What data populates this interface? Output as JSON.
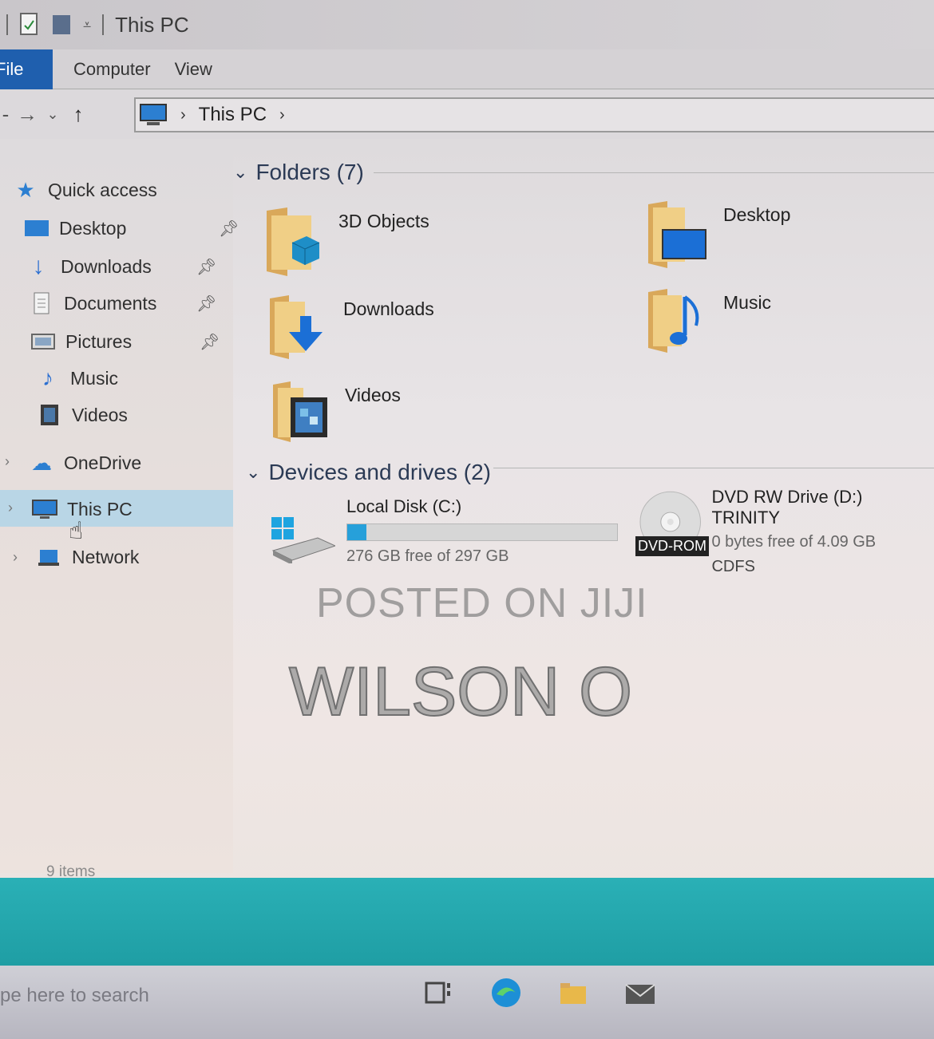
{
  "window": {
    "title": "This PC"
  },
  "ribbon": {
    "file": "File",
    "tabs": [
      "Computer",
      "View"
    ]
  },
  "address": {
    "path": "This PC"
  },
  "sidebar": {
    "quick_access": "Quick access",
    "pinned": [
      "Desktop",
      "Downloads",
      "Documents",
      "Pictures"
    ],
    "unpinned": [
      "Music",
      "Videos"
    ],
    "onedrive": "OneDrive",
    "this_pc": "This PC",
    "network": "Network"
  },
  "folders": {
    "header": "Folders (7)",
    "items": [
      "3D Objects",
      "Desktop",
      "Downloads",
      "Music",
      "Videos"
    ]
  },
  "devices": {
    "header": "Devices and drives (2)",
    "local_disk": {
      "name": "Local Disk (C:)",
      "free": "276 GB free of 297 GB",
      "used_fraction": 0.07
    },
    "dvd": {
      "name": "DVD RW Drive (D:) TRINITY",
      "free": "0 bytes free of 4.09 GB",
      "fs": "CDFS",
      "tag": "DVD-ROM"
    }
  },
  "status": {
    "items": "9 items"
  },
  "watermark": {
    "line1": "POSTED ON JIJI",
    "line2": "WILSON O"
  },
  "taskbar": {
    "search": "pe here to search"
  },
  "colors": {
    "accent": "#1f5fae",
    "selection": "#b9d6e6",
    "desktop": "#2ab0b6",
    "bar": "#26a0da"
  }
}
